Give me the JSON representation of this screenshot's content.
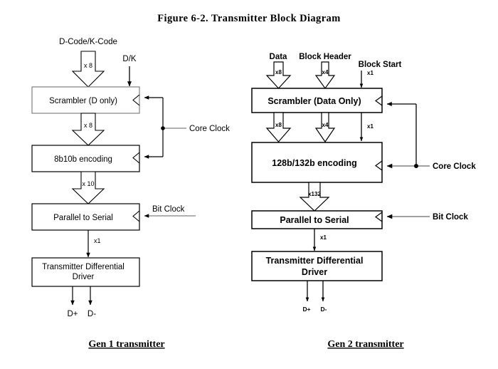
{
  "figure": {
    "title": "Figure 6-2.  Transmitter Block Diagram"
  },
  "gen1": {
    "caption": "Gen 1 transmitter",
    "inputs": {
      "data_label": "D-Code/K-Code",
      "data_width": "x 8",
      "dk_label": "D/K"
    },
    "blocks": {
      "scrambler": "Scrambler (D only)",
      "encoding": "8b10b encoding",
      "serializer": "Parallel to Serial",
      "driver_line1": "Transmitter Differential",
      "driver_line2": "Driver"
    },
    "buses": {
      "scrambler_out": "x 8",
      "encoder_out": "x 10",
      "serial_out": "x1"
    },
    "clocks": {
      "core": "Core Clock",
      "bit": "Bit Clock"
    },
    "outputs": {
      "dplus": "D+",
      "dminus": "D-"
    }
  },
  "gen2": {
    "caption": "Gen 2 transmitter",
    "inputs": {
      "data_label": "Data",
      "data_width": "x8",
      "header_label": "Block Header",
      "header_width": "x4",
      "start_label": "Block Start",
      "start_width": "x1"
    },
    "blocks": {
      "scrambler": "Scrambler (Data Only)",
      "encoding": "128b/132b encoding",
      "serializer": "Parallel to Serial",
      "driver_line1": "Transmitter Differential",
      "driver_line2": "Driver"
    },
    "buses": {
      "scrambler_out_data": "x8",
      "scrambler_out_header": "x4",
      "scrambler_out_start": "x1",
      "encoder_out": "x132",
      "serial_out": "x1"
    },
    "clocks": {
      "core": "Core Clock",
      "bit": "Bit Clock"
    },
    "outputs": {
      "dplus": "D+",
      "dminus": "D-"
    }
  },
  "colors": {
    "stroke_black": "#000000",
    "stroke_gray": "#808080",
    "background": "#ffffff"
  }
}
